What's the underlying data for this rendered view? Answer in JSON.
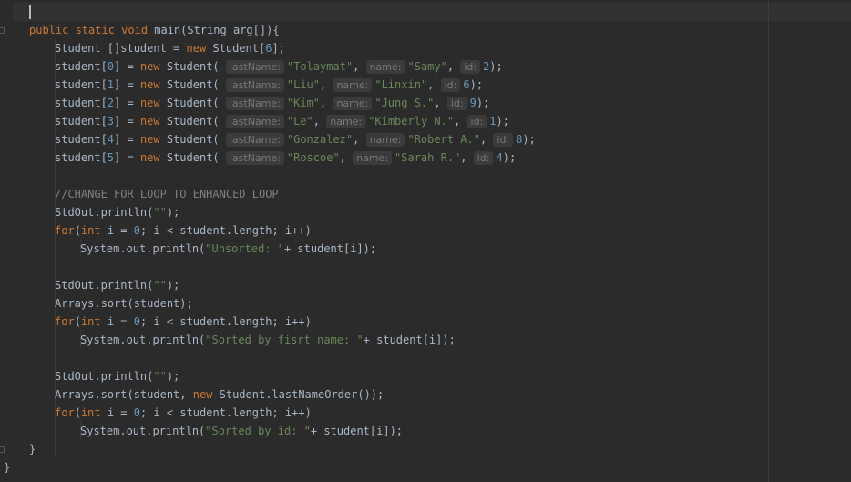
{
  "editor": {
    "method_signature": {
      "modifiers": "public static void",
      "rest": " main(String arg[]){"
    },
    "array_decl": {
      "type": "Student []student = ",
      "kw": "new",
      "rest": " Student[",
      "size": "6",
      "end": "];"
    },
    "hint_labels": {
      "last_name": "lastName:",
      "name": "name:",
      "id": "id:"
    },
    "students": [
      {
        "index": "0",
        "last_name": "\"Tolaymat\"",
        "name": "\"Samy\"",
        "id": "2"
      },
      {
        "index": "1",
        "last_name": "\"Liu\"",
        "name": "\"Linxin\"",
        "id": "6"
      },
      {
        "index": "2",
        "last_name": "\"Kim\"",
        "name": "\"Jung S.\"",
        "id": "9"
      },
      {
        "index": "3",
        "last_name": "\"Le\"",
        "name": "\"Kimberly N.\"",
        "id": "1"
      },
      {
        "index": "4",
        "last_name": "\"Gonzalez\"",
        "name": "\"Robert A.\"",
        "id": "8"
      },
      {
        "index": "5",
        "last_name": "\"Roscoe\"",
        "name": "\"Sarah R.\"",
        "id": "4"
      }
    ],
    "comment": "//CHANGE FOR LOOP TO ENHANCED LOOP",
    "println_call": "StdOut.println(",
    "empty_str": "\"\"",
    "for_kw": "for",
    "int_kw": "int",
    "loop_mid": " i = ",
    "loop_zero": "0",
    "loop_rest": "; i < student.length; i++)",
    "sys_print": "System.out.println(",
    "concat": "+ student[i]);",
    "unsorted_label": "\"Unsorted: \"",
    "sort_call": "Arrays.sort(student);",
    "sorted_first_label": "\"Sorted by fisrt name: \"",
    "sort_last_prefix": "Arrays.sort(student, ",
    "new_kw": "new",
    "sort_last_suffix": " Student.lastNameOrder());",
    "sorted_id_label": "\"Sorted by id: \"",
    "close_brace": "}"
  }
}
